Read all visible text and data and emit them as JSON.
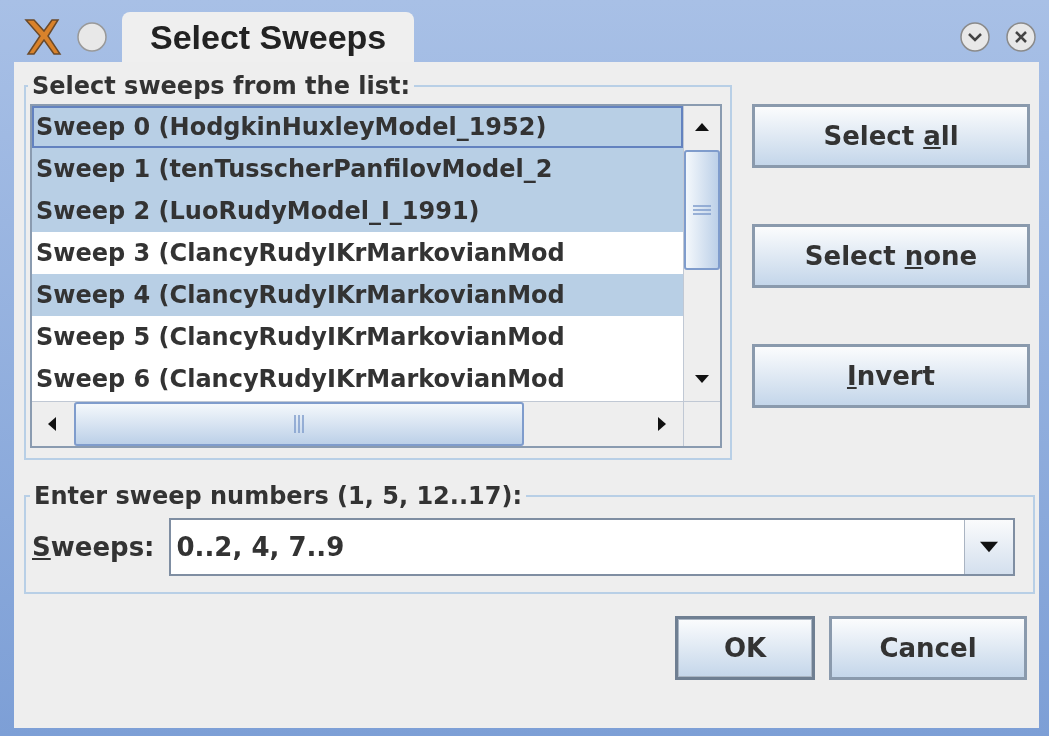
{
  "window": {
    "title": "Select Sweeps"
  },
  "list_group": {
    "legend": "Select sweeps from the list:",
    "items": [
      {
        "label": "Sweep 0 (HodgkinHuxleyModel_1952)",
        "selected": true,
        "focused": true
      },
      {
        "label": "Sweep 1 (tenTusscherPanfilovModel_2",
        "selected": true,
        "focused": false
      },
      {
        "label": "Sweep 2 (LuoRudyModel_I_1991)",
        "selected": true,
        "focused": false
      },
      {
        "label": "Sweep 3 (ClancyRudyIKrMarkovianMod",
        "selected": false,
        "focused": false
      },
      {
        "label": "Sweep 4 (ClancyRudyIKrMarkovianMod",
        "selected": true,
        "focused": false
      },
      {
        "label": "Sweep 5 (ClancyRudyIKrMarkovianMod",
        "selected": false,
        "focused": false
      },
      {
        "label": "Sweep 6 (ClancyRudyIKrMarkovianMod",
        "selected": false,
        "focused": false
      }
    ]
  },
  "side_buttons": [
    {
      "label": {
        "before": "Select ",
        "mnemonic": "a",
        "after": "ll"
      }
    },
    {
      "label": {
        "before": "Select ",
        "mnemonic": "n",
        "after": "one"
      }
    },
    {
      "label": {
        "mnemonic": "I",
        "after": "nvert"
      }
    }
  ],
  "entry_group": {
    "legend": "Enter sweep numbers (1, 5, 12..17):",
    "label": {
      "mnemonic": "S",
      "after": "weeps:"
    },
    "value": "0..2, 4, 7..9"
  },
  "buttons": [
    {
      "label": "OK",
      "default": true
    },
    {
      "label": "Cancel",
      "default": false
    }
  ]
}
